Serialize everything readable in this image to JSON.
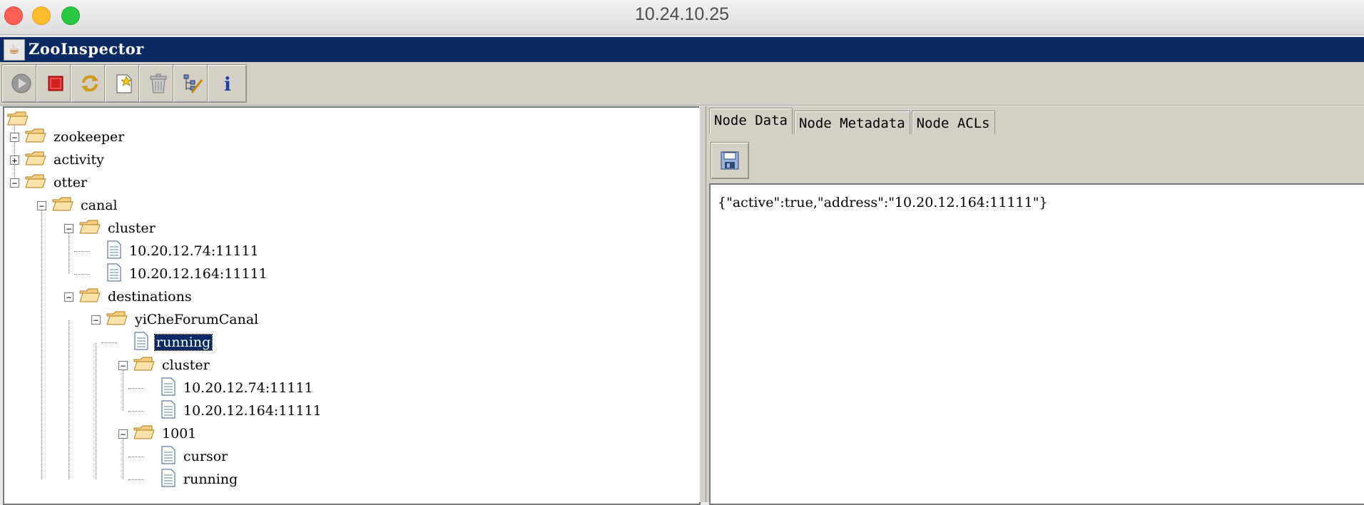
{
  "window": {
    "title": "10.24.10.25"
  },
  "app": {
    "title": "ZooInspector"
  },
  "toolbar": {
    "buttons": [
      {
        "name": "connect-icon"
      },
      {
        "name": "disconnect-icon"
      },
      {
        "name": "refresh-icon"
      },
      {
        "name": "add-node-icon"
      },
      {
        "name": "delete-node-icon"
      },
      {
        "name": "node-viewers-icon"
      },
      {
        "name": "about-icon",
        "glyph": "i"
      }
    ]
  },
  "tree": {
    "nodes": [
      {
        "label": "zookeeper",
        "type": "folder",
        "toggle": "−"
      },
      {
        "label": "activity",
        "type": "folder",
        "toggle": "+"
      },
      {
        "label": "otter",
        "type": "folder",
        "toggle": "−"
      },
      {
        "label": "canal",
        "type": "folder",
        "toggle": "−"
      },
      {
        "label": "cluster",
        "type": "folder",
        "toggle": "−"
      },
      {
        "label": "10.20.12.74:11111",
        "type": "file"
      },
      {
        "label": "10.20.12.164:11111",
        "type": "file"
      },
      {
        "label": "destinations",
        "type": "folder",
        "toggle": "−"
      },
      {
        "label": "yiCheForumCanal",
        "type": "folder",
        "toggle": "−"
      },
      {
        "label": "running",
        "type": "file",
        "selected": true
      },
      {
        "label": "cluster",
        "type": "folder",
        "toggle": "−"
      },
      {
        "label": "10.20.12.74:11111",
        "type": "file"
      },
      {
        "label": "10.20.12.164:11111",
        "type": "file"
      },
      {
        "label": "1001",
        "type": "folder",
        "toggle": "−"
      },
      {
        "label": "cursor",
        "type": "file"
      },
      {
        "label": "running",
        "type": "file"
      }
    ]
  },
  "tabs": [
    {
      "label": "Node Data",
      "active": true
    },
    {
      "label": "Node Metadata",
      "active": false
    },
    {
      "label": "Node ACLs",
      "active": false
    }
  ],
  "node_data": {
    "content": "{\"active\":true,\"address\":\"10.20.12.164:11111\"}"
  }
}
